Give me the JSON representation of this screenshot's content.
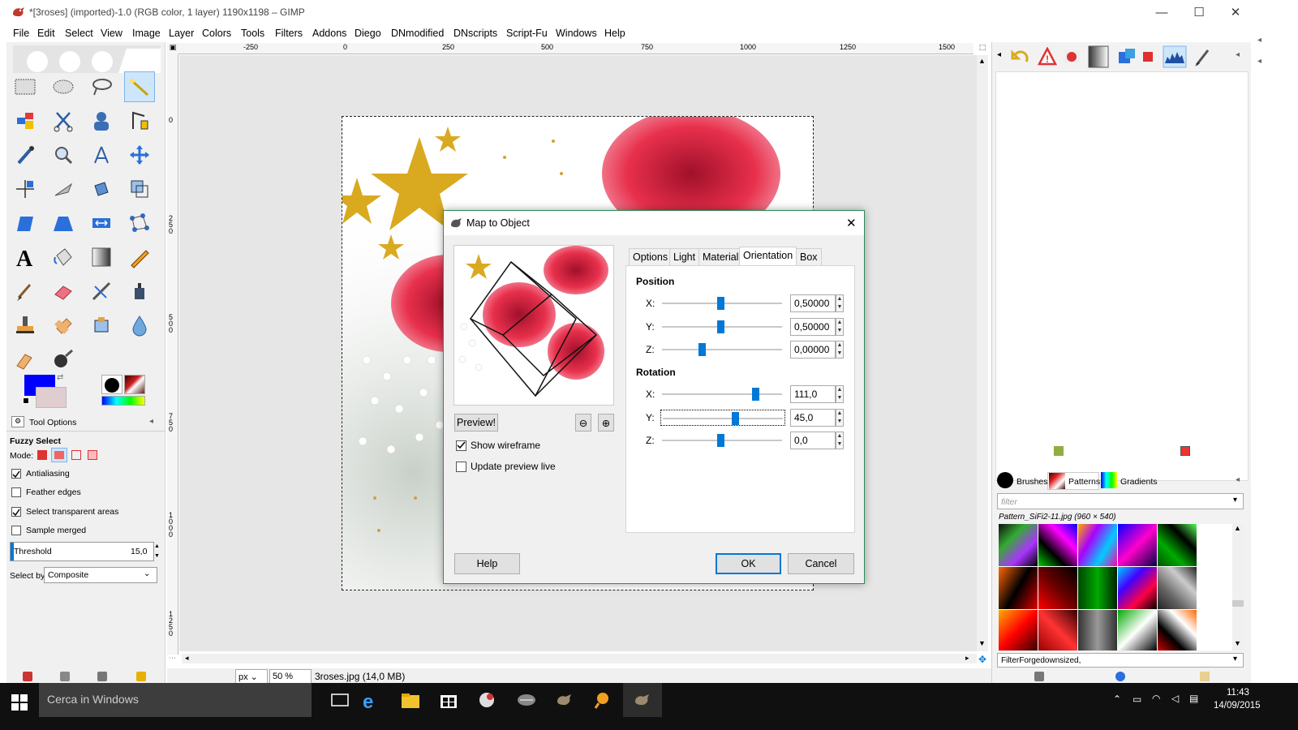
{
  "window": {
    "title": "*[3roses] (imported)-1.0 (RGB color, 1 layer) 1190x1198 – GIMP",
    "min_icon": "minimize-icon",
    "max_icon": "maximize-icon",
    "close_icon": "close-icon"
  },
  "menu": [
    "File",
    "Edit",
    "Select",
    "View",
    "Image",
    "Layer",
    "Colors",
    "Tools",
    "Filters",
    "Addons",
    "Diego",
    "DNmodified",
    "DNscripts",
    "Script-Fu",
    "Windows",
    "Help"
  ],
  "ruler": {
    "top_ticks": [
      "-250",
      "0",
      "250",
      "500",
      "750",
      "1000",
      "1250",
      "1500"
    ],
    "left_ticks": [
      "0",
      "250",
      "500",
      "750",
      "1000",
      "1250"
    ]
  },
  "tool_options": {
    "tab_label": "Tool Options",
    "tool_name": "Fuzzy Select",
    "mode_label": "Mode:",
    "antialiasing": {
      "label": "Antialiasing",
      "checked": true
    },
    "feather": {
      "label": "Feather edges",
      "checked": false
    },
    "transparent": {
      "label": "Select transparent areas",
      "checked": true
    },
    "sample_merged": {
      "label": "Sample merged",
      "checked": false
    },
    "threshold": {
      "label": "Threshold",
      "value": "15,0"
    },
    "select_by": {
      "label": "Select by:",
      "value": "Composite"
    }
  },
  "status": {
    "unit": "px",
    "zoom": "50 %",
    "file": "3roses.jpg (14,0 MB)"
  },
  "dialog": {
    "title": "Map to Object",
    "tabs": [
      "Options",
      "Light",
      "Material",
      "Orientation",
      "Box"
    ],
    "active_tab": "Orientation",
    "preview_button": "Preview!",
    "show_wireframe": {
      "label": "Show wireframe",
      "checked": true
    },
    "update_preview": {
      "label": "Update preview live",
      "checked": false
    },
    "position": {
      "heading": "Position",
      "rows": [
        {
          "label": "X:",
          "value": "0,50000",
          "fraction": 0.5
        },
        {
          "label": "Y:",
          "value": "0,50000",
          "fraction": 0.5
        },
        {
          "label": "Z:",
          "value": "0,00000",
          "fraction": 0.34
        }
      ]
    },
    "rotation": {
      "heading": "Rotation",
      "rows": [
        {
          "label": "X:",
          "value": "111,0",
          "fraction": 0.8
        },
        {
          "label": "Y:",
          "value": "45,0",
          "fraction": 0.62
        },
        {
          "label": "Z:",
          "value": "0,0",
          "fraction": 0.5
        }
      ]
    },
    "help_button": "Help",
    "ok_button": "OK",
    "cancel_button": "Cancel"
  },
  "dock": {
    "tabs": [
      "Brushes",
      "Patterns",
      "Gradients"
    ],
    "filter_placeholder": "filter",
    "pattern_name": "Pattern_SiFi2-11.jpg (960 × 540)",
    "bottom_select": "FilterForgedownsized,"
  },
  "taskbar": {
    "search_placeholder": "Cerca in Windows",
    "time": "11:43",
    "date": "14/09/2015"
  },
  "colors": {
    "foreground": "#0000ff",
    "background": "#e0cdd0",
    "accent": "#0078d7",
    "dialog_border": "#2e8b57"
  }
}
